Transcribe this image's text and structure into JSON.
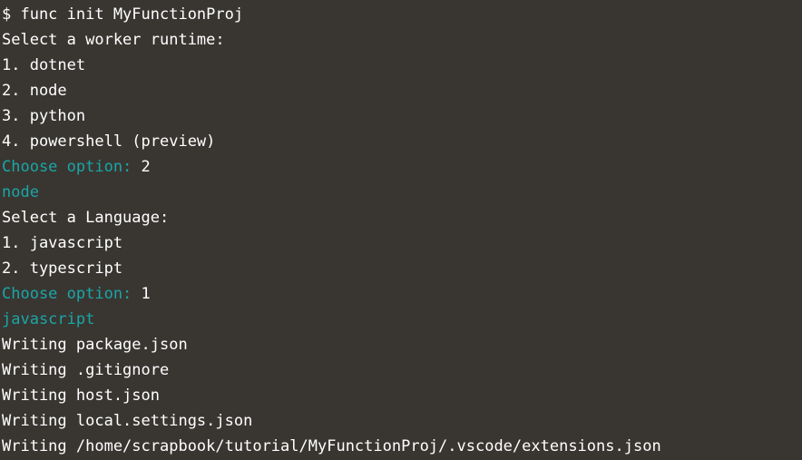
{
  "colors": {
    "background": "#393632",
    "text": "#ffffff",
    "accent": "#1aa6a6"
  },
  "terminal": {
    "command": "$ func init MyFunctionProj",
    "runtime_prompt": "Select a worker runtime:",
    "runtime_options": [
      "1. dotnet",
      "2. node",
      "3. python",
      "4. powershell (preview)"
    ],
    "choose_label_1": "Choose option: ",
    "choose_answer_1": "2",
    "runtime_echo": "node",
    "language_prompt": "Select a Language:",
    "language_options": [
      "1. javascript",
      "2. typescript"
    ],
    "choose_label_2": "Choose option: ",
    "choose_answer_2": "1",
    "language_echo": "javascript",
    "writing_lines": [
      "Writing package.json",
      "Writing .gitignore",
      "Writing host.json",
      "Writing local.settings.json",
      "Writing /home/scrapbook/tutorial/MyFunctionProj/.vscode/extensions.json"
    ]
  }
}
